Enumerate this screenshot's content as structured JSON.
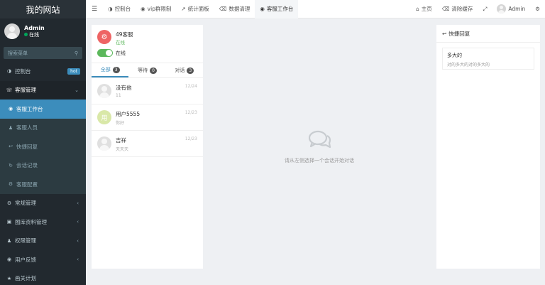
{
  "sidebar": {
    "brand": "我的网站",
    "user": {
      "name": "Admin",
      "status": "在线"
    },
    "search_placeholder": "搜索菜单",
    "items": [
      {
        "label": "控制台",
        "badge": "hot"
      },
      {
        "label": "客服管理"
      },
      {
        "label": "客服工作台"
      },
      {
        "label": "客服人员"
      },
      {
        "label": "快捷回复"
      },
      {
        "label": "会话记录"
      },
      {
        "label": "客服配置"
      },
      {
        "label": "常规管理"
      },
      {
        "label": "图库资料管理"
      },
      {
        "label": "权限管理"
      },
      {
        "label": "用户反馈"
      },
      {
        "label": "画关计划"
      }
    ]
  },
  "topnav": {
    "tabs": [
      "控制台",
      "vip群限制",
      "统计面板",
      "数据清理",
      "客服工作台"
    ],
    "right": {
      "home": "主页",
      "clear_cache": "清除缓存",
      "user": "Admin"
    }
  },
  "chat": {
    "agent_logo": "⚙",
    "agent_name": "49客服",
    "agent_state": "在线",
    "toggle_label": "在线",
    "tabs": [
      {
        "label": "全部",
        "count": "3"
      },
      {
        "label": "等待",
        "count": "0"
      },
      {
        "label": "对话",
        "count": "3"
      }
    ],
    "conversations": [
      {
        "name": "没有他",
        "message": "11",
        "time": "12/24",
        "avatar": ""
      },
      {
        "name": "用户5555",
        "message": "你好",
        "time": "12/23",
        "avatar": "用"
      },
      {
        "name": "吉祥",
        "message": "天天天",
        "time": "12/23",
        "avatar": ""
      }
    ]
  },
  "center": {
    "empty_text": "请从左侧选择一个会话开始对话"
  },
  "quick": {
    "title": "快捷回复",
    "cards": [
      {
        "title": "多大的",
        "desc": "对的多大的对的多大的"
      }
    ]
  },
  "colors": {
    "accent": "#3c8dbc",
    "sidebar_bg": "#22292f",
    "online": "#5cb85c",
    "agent_logo": "#ee6464"
  }
}
